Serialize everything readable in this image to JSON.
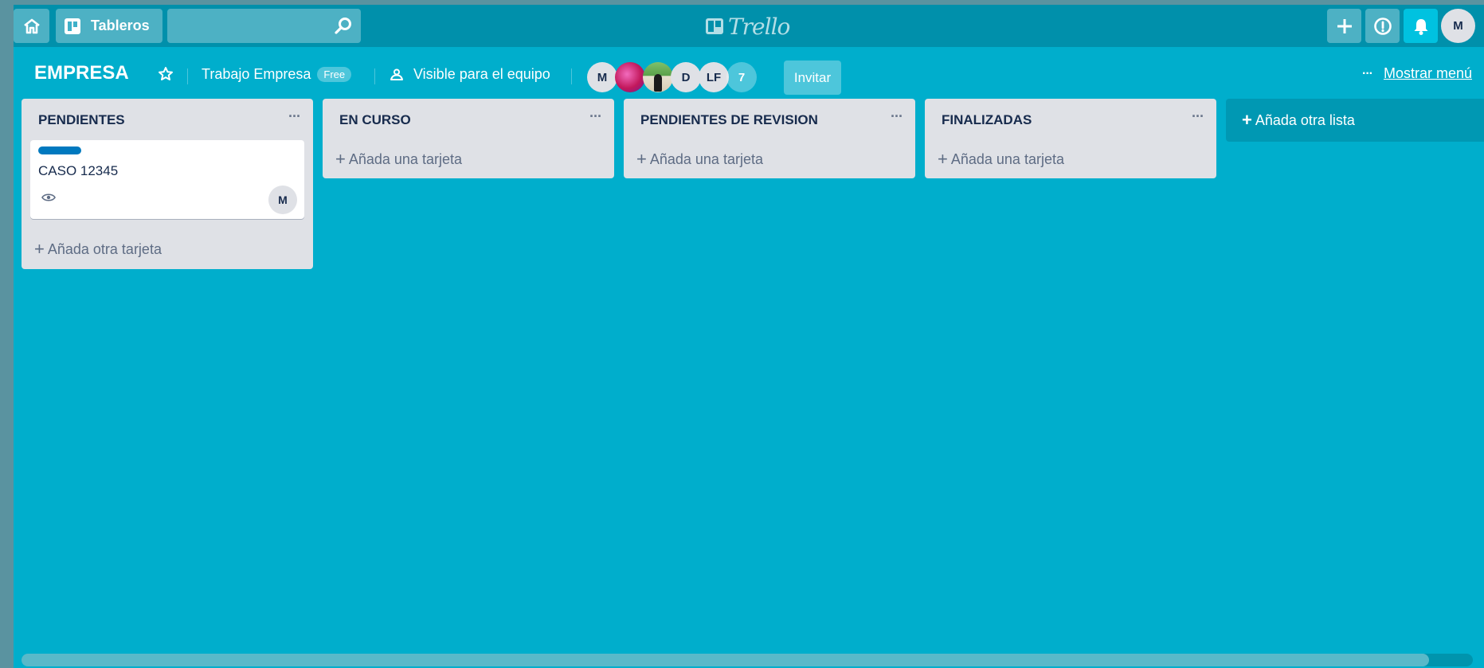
{
  "topbar": {
    "home_icon": "home-icon",
    "boards_label": "Tableros",
    "search_value": "",
    "search_icon": "search-icon",
    "logo_text": "Trello",
    "actions": [
      "plus-icon",
      "info-icon",
      "bell-icon"
    ],
    "user_avatar": "M"
  },
  "board": {
    "title": "EMPRESA",
    "team_name": "Trabajo Empresa",
    "team_badge": "Free",
    "visibility": "Visible para el equipo",
    "members": [
      "M",
      "",
      "",
      "D",
      "LF"
    ],
    "members_more": "7",
    "invite_label": "Invitar",
    "menu_label": "Mostrar menú",
    "menu_dots": "···"
  },
  "lists": [
    {
      "title": "PENDIENTES",
      "menu": "···",
      "cards": [
        {
          "label_color": "#0079bf",
          "title": "CASO 12345",
          "badges": [
            "eye-icon"
          ],
          "member": "M"
        }
      ],
      "add_label": "Añada otra tarjeta"
    },
    {
      "title": "EN CURSO",
      "menu": "···",
      "cards": [],
      "add_label": "Añada una tarjeta"
    },
    {
      "title": "PENDIENTES DE REVISION",
      "menu": "···",
      "cards": [],
      "add_label": "Añada una tarjeta"
    },
    {
      "title": "FINALIZADAS",
      "menu": "···",
      "cards": [],
      "add_label": "Añada una tarjeta"
    }
  ],
  "add_list_label": "Añada otra lista",
  "colors": {
    "board_bg": "#00aecc",
    "topbar_bg": "#0090ab",
    "list_bg": "#dfe1e6",
    "card_label": "#0079bf"
  }
}
